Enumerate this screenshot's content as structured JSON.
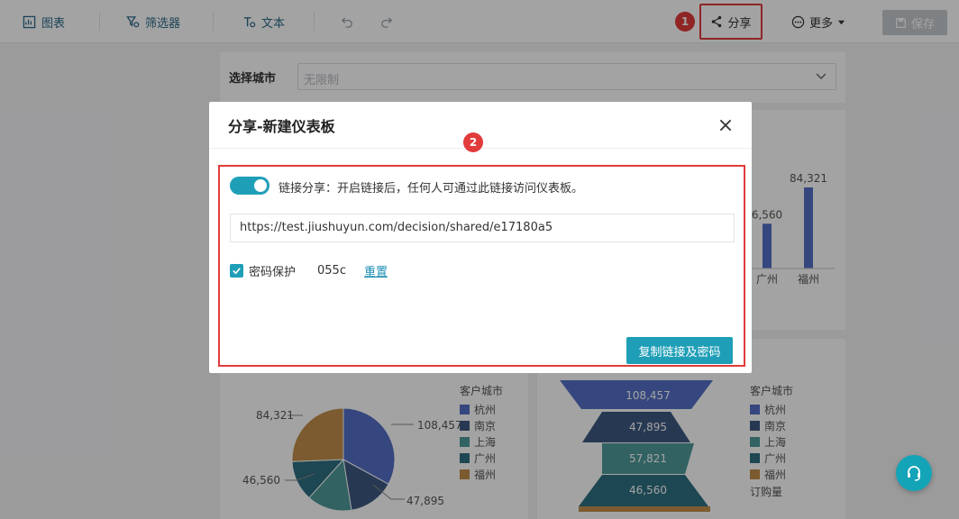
{
  "toolbar": {
    "chart_label": "图表",
    "filter_label": "筛选器",
    "text_label": "文本",
    "share_label": "分享",
    "more_label": "更多",
    "save_label": "保存",
    "step1": "1"
  },
  "filter": {
    "label": "选择城市",
    "value": "无限制"
  },
  "bg_bar_chart": {
    "categories": [
      "广州",
      "福州"
    ],
    "values": [
      46560,
      84321
    ],
    "value_labels": [
      "6,560",
      "84,321"
    ]
  },
  "bg_pie_chart": {
    "legend_title": "客户城市",
    "legend": [
      "杭州",
      "南京",
      "上海",
      "广州",
      "福州"
    ],
    "labels": [
      "108,457",
      "47,895",
      "46,560",
      "84,321"
    ],
    "colors": [
      "#5470c6",
      "#3e5a80",
      "#4f9a9a",
      "#2e6f80",
      "#c08f4a"
    ]
  },
  "bg_funnel_chart": {
    "legend_title": "客户城市",
    "legend": [
      "杭州",
      "南京",
      "上海",
      "广州",
      "福州"
    ],
    "labels": [
      "108,457",
      "47,895",
      "57,821",
      "46,560"
    ],
    "measure_label": "订购量"
  },
  "modal": {
    "title": "分享-新建仪表板",
    "step2": "2",
    "toggle_on": true,
    "share_text": "链接分享：开启链接后，任何人可通过此链接访问仪表板。",
    "url": "https://test.jiushuyun.com/decision/shared/e17180a5",
    "password_label": "密码保护",
    "password_value": "055c",
    "reset_label": "重置",
    "copy_button": "复制链接及密码"
  },
  "colors": {
    "accent": "#1f9fb7",
    "highlight": "#e23b3b"
  }
}
